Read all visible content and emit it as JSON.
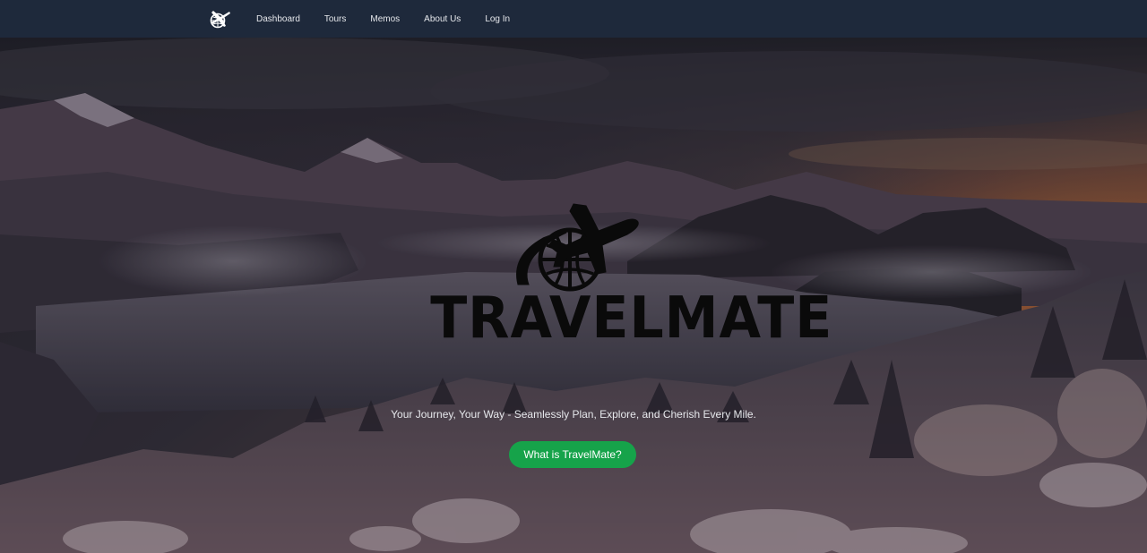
{
  "nav": {
    "brand_icon": "travelmate-logo-icon",
    "links": [
      {
        "label": "Dashboard"
      },
      {
        "label": "Tours"
      },
      {
        "label": "Memos"
      },
      {
        "label": "About Us"
      },
      {
        "label": "Log In"
      }
    ]
  },
  "hero": {
    "logo_icon": "airplane-globe-icon",
    "title": "TRAVELMATE",
    "tagline": "Your Journey, Your Way - Seamlessly Plan, Explore, and Cherish Every Mile.",
    "cta_label": "What is TravelMate?",
    "background": "snowy-mountain-lake-sunset-image"
  },
  "colors": {
    "navbar_bg": "#1e293b",
    "cta_bg": "#16a34a",
    "title_color": "#0a0a0a",
    "sunset_accent": "#e0782f"
  }
}
